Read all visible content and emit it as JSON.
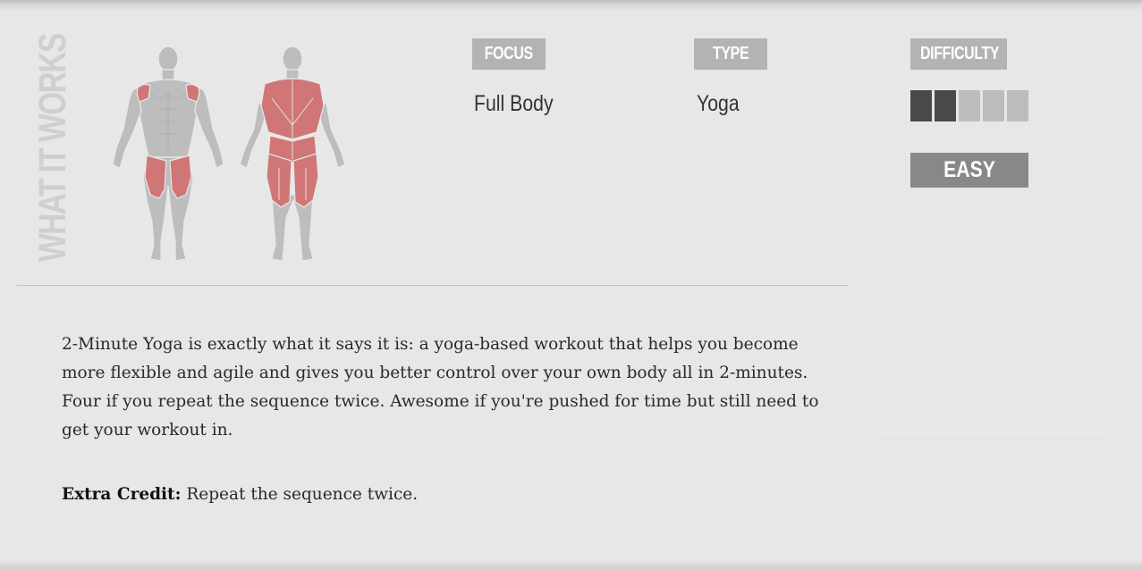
{
  "section": {
    "title": "WHAT IT WORKS"
  },
  "focus": {
    "label": "FOCUS",
    "value": "Full Body"
  },
  "type": {
    "label": "TYPE",
    "value": "Yoga"
  },
  "difficulty": {
    "label": "DIFFICULTY",
    "level": 2,
    "max_level": 5,
    "level_name": "EASY"
  },
  "description": {
    "text": "2-Minute Yoga is exactly what it says it is: a yoga-based workout that helps you become more flexible and agile and gives you better control over your own body all in 2-minutes. Four if you repeat the sequence twice. Awesome if you're pushed for time but still need to get your workout in.",
    "extra_label": "Extra Credit:",
    "extra_text": " Repeat the sequence twice."
  },
  "colors": {
    "muscle_highlight": "#d07676",
    "body_base": "#bdbdbd",
    "tag_bg": "#b3b3b3",
    "difficulty_filled": "#494949",
    "difficulty_empty": "#bcbcbc",
    "level_badge_bg": "#888888"
  }
}
